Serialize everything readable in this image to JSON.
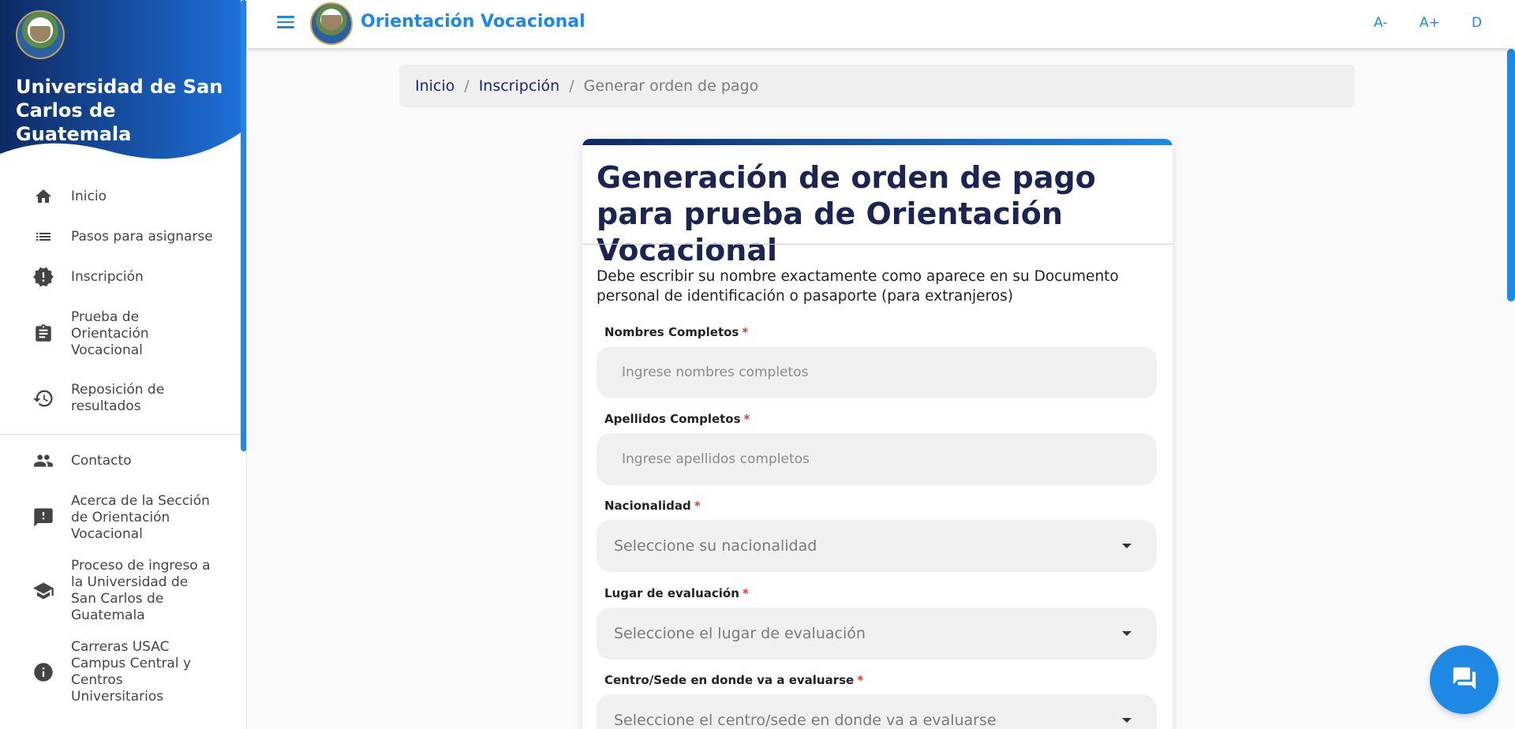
{
  "sidebar": {
    "university_name": "Universidad de San Carlos de Guatemala",
    "items": [
      {
        "label": "Inicio",
        "icon": "home-icon"
      },
      {
        "label": "Pasos para asignarse",
        "icon": "list-icon"
      },
      {
        "label": "Inscripción",
        "icon": "alert-badge-icon"
      },
      {
        "label": "Prueba de Orientación Vocacional",
        "icon": "clipboard-icon"
      },
      {
        "label": "Reposición de resultados",
        "icon": "history-icon"
      },
      {
        "label": "Contacto",
        "icon": "people-icon"
      },
      {
        "label": "Acerca de la Sección de Orientación Vocacional",
        "icon": "feedback-icon"
      },
      {
        "label": "Proceso de ingreso a la Universidad de San Carlos de Guatemala",
        "icon": "school-icon"
      },
      {
        "label": "Carreras USAC Campus Central y Centros Universitarios",
        "icon": "info-icon"
      }
    ]
  },
  "header": {
    "title": "Orientación Vocacional",
    "font_decrease": "A-",
    "font_increase": "A+",
    "theme_toggle": "D"
  },
  "breadcrumb": {
    "home": "Inicio",
    "separator": "/",
    "registration": "Inscripción",
    "current": "Generar orden de pago"
  },
  "form": {
    "title": "Generación de orden de pago para prueba de Orientación Vocacional",
    "intro": "Debe escribir su nombre exactamente como aparece en su Documento personal de identificación o pasaporte (para extranjeros)",
    "required_mark": "*",
    "names": {
      "label": "Nombres Completos",
      "placeholder": "Ingrese nombres completos",
      "value": ""
    },
    "surnames": {
      "label": "Apellidos Completos",
      "placeholder": "Ingrese apellidos completos",
      "value": ""
    },
    "nationality": {
      "label": "Nacionalidad",
      "selected": "Seleccione su nacionalidad"
    },
    "place": {
      "label": "Lugar de evaluación",
      "selected": "Seleccione el lugar de evaluación"
    },
    "center": {
      "label": "Centro/Sede en donde va a evaluarse",
      "selected": "Seleccione el centro/sede en donde va a evaluarse"
    }
  },
  "colors": {
    "primary": "#1e88e5",
    "dark_blue": "#0d2a63",
    "title": "#1c2452",
    "required": "#e53935"
  },
  "chat": {
    "icon": "chat-icon"
  }
}
